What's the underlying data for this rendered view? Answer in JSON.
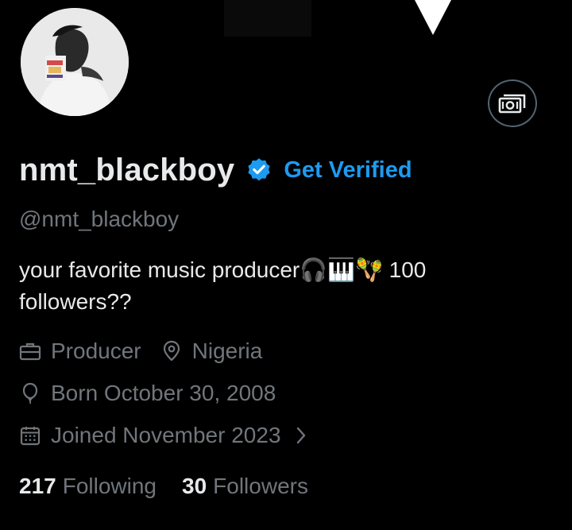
{
  "profile": {
    "display_name": "nmt_blackboy",
    "get_verified_label": "Get Verified",
    "handle": "@nmt_blackboy",
    "bio": "your favorite music producer🎧🎹🪇 100 followers??",
    "work": "Producer",
    "location": "Nigeria",
    "birthday": "Born October 30, 2008",
    "joined": "Joined November 2023",
    "following_count": "217",
    "following_label": "Following",
    "followers_count": "30",
    "followers_label": "Followers"
  },
  "icons": {
    "tip": "money-icon",
    "verified": "verified-badge-icon",
    "work": "briefcase-icon",
    "location": "location-pin-icon",
    "birthday": "balloon-icon",
    "joined": "calendar-icon",
    "joined_chevron": "chevron-right-icon"
  },
  "colors": {
    "background": "#000000",
    "primary_text": "#e7e9ea",
    "secondary_text": "#71767b",
    "accent": "#1d9bf0"
  }
}
